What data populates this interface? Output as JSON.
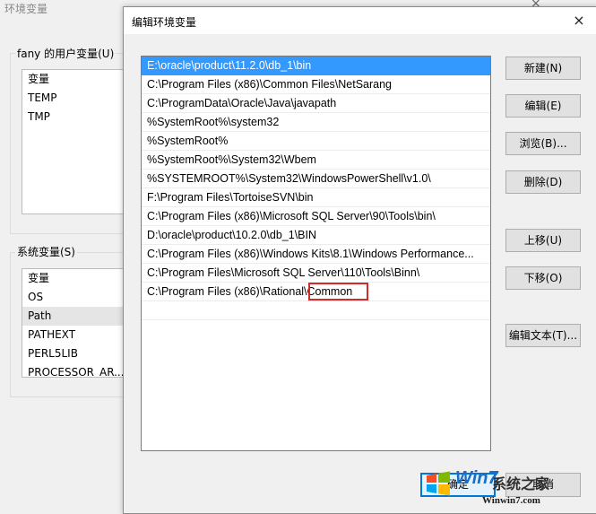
{
  "background_window": {
    "title": "环境变量",
    "close_icon": "×",
    "user_vars": {
      "group_label": "fany 的用户变量(U)",
      "header": "变量",
      "rows": [
        "TEMP",
        "TMP"
      ]
    },
    "system_vars": {
      "group_label": "系统变量(S)",
      "header": "变量",
      "rows": [
        "OS",
        "Path",
        "PATHEXT",
        "PERL5LIB",
        "PROCESSOR_AR..."
      ],
      "selected": "Path"
    }
  },
  "dialog": {
    "title": "编辑环境变量",
    "close_icon": "×",
    "paths": [
      "E:\\oracle\\product\\11.2.0\\db_1\\bin",
      "C:\\Program Files (x86)\\Common Files\\NetSarang",
      "C:\\ProgramData\\Oracle\\Java\\javapath",
      "%SystemRoot%\\system32",
      "%SystemRoot%",
      "%SystemRoot%\\System32\\Wbem",
      "%SYSTEMROOT%\\System32\\WindowsPowerShell\\v1.0\\",
      "F:\\Program Files\\TortoiseSVN\\bin",
      "C:\\Program Files (x86)\\Microsoft SQL Server\\90\\Tools\\bin\\",
      "D:\\oracle\\product\\10.2.0\\db_1\\BIN",
      "C:\\Program Files (x86)\\Windows Kits\\8.1\\Windows Performance...",
      "C:\\Program Files\\Microsoft SQL Server\\110\\Tools\\Binn\\",
      "C:\\Program Files (x86)\\Rational\\Common"
    ],
    "selected_index": 0,
    "editing_index": 12,
    "buttons": {
      "new": "新建(N)",
      "edit": "编辑(E)",
      "browse": "浏览(B)...",
      "delete": "删除(D)",
      "move_up": "上移(U)",
      "move_down": "下移(O)",
      "edit_text": "编辑文本(T)...",
      "ok": "确定",
      "cancel": "取消"
    },
    "highlight_color": "#d42a2a",
    "selection_color": "#3399ff"
  },
  "watermark": {
    "brand": "Win7",
    "site_name": "系统之家",
    "url": "Winwin7.com"
  }
}
